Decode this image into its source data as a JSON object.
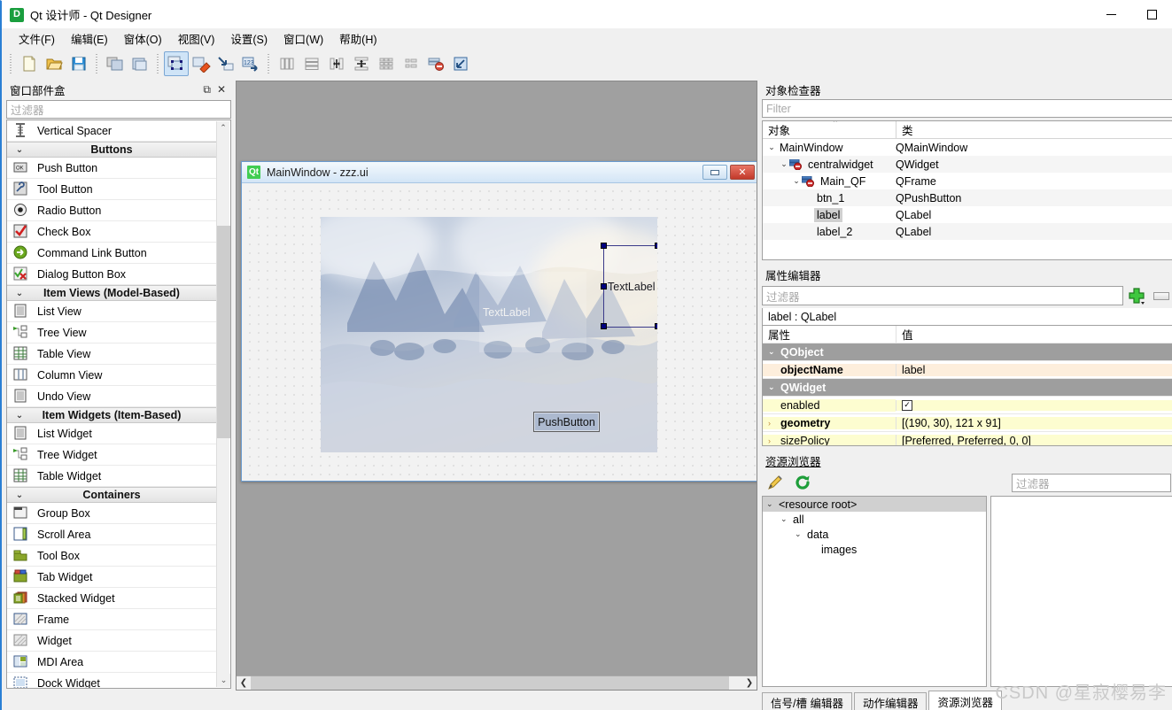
{
  "window": {
    "title": "Qt 设计师 - Qt Designer",
    "app_icon": "D",
    "minimize_label": "minimize",
    "maximize_label": "maximize"
  },
  "menubar": {
    "items": [
      {
        "label": "文件(F)",
        "name": "menu-file"
      },
      {
        "label": "编辑(E)",
        "name": "menu-edit"
      },
      {
        "label": "窗体(O)",
        "name": "menu-form"
      },
      {
        "label": "视图(V)",
        "name": "menu-view"
      },
      {
        "label": "设置(S)",
        "name": "menu-settings"
      },
      {
        "label": "窗口(W)",
        "name": "menu-window"
      },
      {
        "label": "帮助(H)",
        "name": "menu-help"
      }
    ]
  },
  "toolbar": {
    "groups": [
      [
        "new-file-icon",
        "open-file-icon",
        "save-icon"
      ],
      [
        "copy-icon",
        "paste-icon"
      ],
      [
        "edit-widgets-icon",
        "edit-signals-slots-icon",
        "edit-buddies-icon",
        "edit-tab-order-icon"
      ],
      [
        "layout-horizontally-icon",
        "layout-vertically-icon",
        "layout-splitter-horizontal-icon",
        "layout-splitter-vertical-icon",
        "layout-grid-icon",
        "layout-form-icon",
        "break-layout-icon",
        "adjust-size-icon"
      ]
    ]
  },
  "widgetbox": {
    "title": "窗口部件盒",
    "undock_label": "⧉",
    "close_label": "✕",
    "filter_placeholder": "过滤器",
    "items": [
      {
        "type": "item",
        "label": "Vertical Spacer",
        "icon": "vertical-spacer-icon"
      },
      {
        "type": "category",
        "label": "Buttons"
      },
      {
        "type": "item",
        "label": "Push Button",
        "icon": "push-button-icon"
      },
      {
        "type": "item",
        "label": "Tool Button",
        "icon": "tool-button-icon"
      },
      {
        "type": "item",
        "label": "Radio Button",
        "icon": "radio-button-icon"
      },
      {
        "type": "item",
        "label": "Check Box",
        "icon": "check-box-icon"
      },
      {
        "type": "item",
        "label": "Command Link Button",
        "icon": "command-link-button-icon"
      },
      {
        "type": "item",
        "label": "Dialog Button Box",
        "icon": "dialog-button-box-icon"
      },
      {
        "type": "category",
        "label": "Item Views (Model-Based)"
      },
      {
        "type": "item",
        "label": "List View",
        "icon": "list-view-icon"
      },
      {
        "type": "item",
        "label": "Tree View",
        "icon": "tree-view-icon"
      },
      {
        "type": "item",
        "label": "Table View",
        "icon": "table-view-icon"
      },
      {
        "type": "item",
        "label": "Column View",
        "icon": "column-view-icon"
      },
      {
        "type": "item",
        "label": "Undo View",
        "icon": "undo-view-icon"
      },
      {
        "type": "category",
        "label": "Item Widgets (Item-Based)"
      },
      {
        "type": "item",
        "label": "List Widget",
        "icon": "list-widget-icon"
      },
      {
        "type": "item",
        "label": "Tree Widget",
        "icon": "tree-widget-icon"
      },
      {
        "type": "item",
        "label": "Table Widget",
        "icon": "table-widget-icon"
      },
      {
        "type": "category",
        "label": "Containers"
      },
      {
        "type": "item",
        "label": "Group Box",
        "icon": "group-box-icon"
      },
      {
        "type": "item",
        "label": "Scroll Area",
        "icon": "scroll-area-icon"
      },
      {
        "type": "item",
        "label": "Tool Box",
        "icon": "tool-box-icon"
      },
      {
        "type": "item",
        "label": "Tab Widget",
        "icon": "tab-widget-icon"
      },
      {
        "type": "item",
        "label": "Stacked Widget",
        "icon": "stacked-widget-icon"
      },
      {
        "type": "item",
        "label": "Frame",
        "icon": "frame-icon"
      },
      {
        "type": "item",
        "label": "Widget",
        "icon": "widget-icon"
      },
      {
        "type": "item",
        "label": "MDI Area",
        "icon": "mdi-area-icon"
      },
      {
        "type": "item",
        "label": "Dock Widget",
        "icon": "dock-widget-icon"
      }
    ]
  },
  "form": {
    "title": "MainWindow - zzz.ui",
    "icon_text": "Qt",
    "minimize_label": "minimize",
    "close_label": "✕",
    "label_1_text": "TextLabel",
    "label_2_text": "TextLabel",
    "pushbutton_text": "PushButton"
  },
  "object_inspector": {
    "title": "对象检查器",
    "filter_placeholder": "Filter",
    "columns": [
      "对象",
      "类"
    ],
    "rows": [
      {
        "indent": 0,
        "expander": "⌄",
        "icon": "",
        "name": "MainWindow",
        "class": "QMainWindow",
        "selected": false
      },
      {
        "indent": 1,
        "expander": "⌄",
        "icon": "widget-layout-icon",
        "name": "centralwidget",
        "class": "QWidget",
        "selected": false
      },
      {
        "indent": 2,
        "expander": "⌄",
        "icon": "widget-layout-icon",
        "name": "Main_QF",
        "class": "QFrame",
        "selected": false
      },
      {
        "indent": 3,
        "expander": "",
        "icon": "",
        "name": "btn_1",
        "class": "QPushButton",
        "selected": false
      },
      {
        "indent": 3,
        "expander": "",
        "icon": "",
        "name": "label",
        "class": "QLabel",
        "selected": true
      },
      {
        "indent": 3,
        "expander": "",
        "icon": "",
        "name": "label_2",
        "class": "QLabel",
        "selected": false
      }
    ]
  },
  "property_editor": {
    "title": "属性编辑器",
    "filter_placeholder": "过滤器",
    "add_button_label": "+",
    "object_header": "label : QLabel",
    "columns": [
      "属性",
      "值"
    ],
    "rows": [
      {
        "kind": "group",
        "name": "QObject",
        "value": "",
        "expander": "⌄"
      },
      {
        "kind": "prop",
        "name": "objectName",
        "value": "label",
        "bold": true,
        "tint": "beige",
        "expander": ""
      },
      {
        "kind": "group",
        "name": "QWidget",
        "value": "",
        "expander": "⌄"
      },
      {
        "kind": "prop",
        "name": "enabled",
        "value": "",
        "checkbox": true,
        "checked": true,
        "bold": false,
        "tint": "yellow",
        "expander": ""
      },
      {
        "kind": "prop",
        "name": "geometry",
        "value": "[(190, 30), 121 x 91]",
        "bold": true,
        "tint": "yellow",
        "expander": "›"
      },
      {
        "kind": "prop",
        "name": "sizePolicy",
        "value": "[Preferred, Preferred, 0, 0]",
        "bold": false,
        "tint": "yellow",
        "expander": "›"
      }
    ]
  },
  "resource_browser": {
    "title": "资源浏览器",
    "edit_icon": "pencil-edit-icon",
    "reload_icon": "reload-icon",
    "filter_placeholder": "过滤器",
    "tree": [
      {
        "indent": 0,
        "expander": "⌄",
        "label": "<resource root>",
        "selected": true
      },
      {
        "indent": 1,
        "expander": "⌄",
        "label": "all",
        "selected": false
      },
      {
        "indent": 2,
        "expander": "⌄",
        "label": "data",
        "selected": false
      },
      {
        "indent": 3,
        "expander": "",
        "label": "images",
        "selected": false
      }
    ]
  },
  "bottom_tabs": [
    {
      "label": "信号/槽 编辑器",
      "selected": false
    },
    {
      "label": "动作编辑器",
      "selected": false
    },
    {
      "label": "资源浏览器",
      "selected": true
    }
  ],
  "watermark": "CSDN @星寂樱易李",
  "colors": {
    "accent": "#2a7fd4",
    "selection": "#d0d0d0",
    "handle": "#00007f",
    "qt_green": "#41cd52",
    "property_beige": "#fdeedc",
    "property_yellow": "#fdfdd0"
  }
}
